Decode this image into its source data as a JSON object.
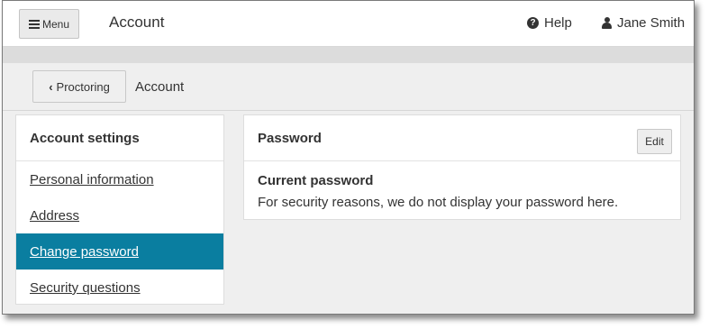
{
  "header": {
    "menu_label": "Menu",
    "title": "Account",
    "help_label": "Help",
    "user_name": "Jane Smith"
  },
  "breadcrumb": {
    "back_label": "Proctoring",
    "current": "Account"
  },
  "sidebar": {
    "heading": "Account settings",
    "items": [
      {
        "label": "Personal information",
        "active": false
      },
      {
        "label": "Address",
        "active": false
      },
      {
        "label": "Change password",
        "active": true
      },
      {
        "label": "Security questions",
        "active": false
      }
    ]
  },
  "panel": {
    "title": "Password",
    "edit_label": "Edit",
    "field_label": "Current password",
    "field_note": "For security reasons, we do not display your password here."
  },
  "colors": {
    "active_item_bg": "#0a7ea0",
    "page_bg": "#efefef"
  },
  "icons": [
    "hamburger-icon",
    "help-icon",
    "user-icon",
    "chevron-left-icon"
  ]
}
